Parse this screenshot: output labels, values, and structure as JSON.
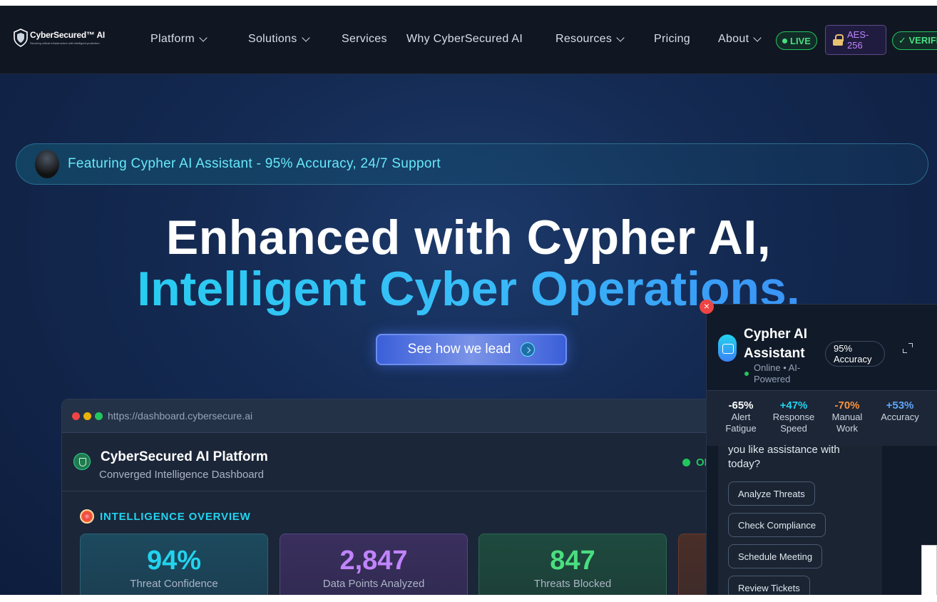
{
  "nav": {
    "logo_text": "CyberSecured™ AI",
    "logo_tagline": "Securing critical infrastructure with intelligent protection",
    "items": [
      {
        "label": "Platform",
        "dropdown": true
      },
      {
        "label": "Solutions",
        "dropdown": true
      },
      {
        "label": "Services",
        "dropdown": false
      },
      {
        "label": "Why CyberSecured AI",
        "dropdown": false
      },
      {
        "label": "Resources",
        "dropdown": true
      },
      {
        "label": "Pricing",
        "dropdown": false
      },
      {
        "label": "About",
        "dropdown": true
      }
    ],
    "badge_live": "LIVE",
    "badge_aes": "AES-256",
    "badge_verified": "✓ VERIFIED"
  },
  "banner": {
    "text": "Featuring Cypher AI Assistant - 95% Accuracy, 24/7 Support"
  },
  "hero": {
    "line1": "Enhanced with Cypher AI,",
    "line2": "Intelligent Cyber Operations.",
    "cta_label": "See how we lead"
  },
  "dashboard": {
    "url": "https://dashboard.cybersecure.ai",
    "title": "CyberSecured AI Platform",
    "subtitle": "Converged Intelligence Dashboard",
    "status": "ONLINE",
    "section_label": "INTELLIGENCE OVERVIEW",
    "cards": [
      {
        "value": "94%",
        "label": "Threat Confidence",
        "color": "#22d3ee"
      },
      {
        "value": "2,847",
        "label": "Data Points Analyzed",
        "color": "#c084fc"
      },
      {
        "value": "847",
        "label": "Threats Blocked",
        "color": "#4ade80"
      }
    ]
  },
  "chat": {
    "title": "Cypher AI Assistant",
    "status": "Online • AI-Powered",
    "accuracy_badge": "95% Accuracy",
    "metrics": [
      {
        "value": "-65%",
        "label": "Alert Fatigue",
        "color": "#ffffff"
      },
      {
        "value": "+47%",
        "label": "Response Speed",
        "color": "#22d3ee"
      },
      {
        "value": "-70%",
        "label": "Manual Work",
        "color": "#fb923c"
      },
      {
        "value": "+53%",
        "label": "Accuracy",
        "color": "#60a5fa"
      }
    ],
    "message_partial": "you like assistance with today?",
    "quick_actions": [
      "Analyze Threats",
      "Check Compliance",
      "Schedule Meeting",
      "Review Tickets"
    ]
  }
}
